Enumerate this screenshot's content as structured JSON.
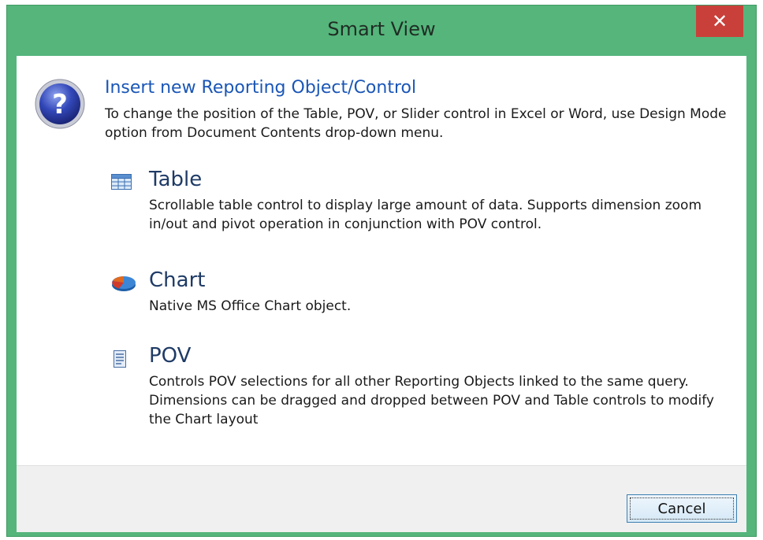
{
  "window": {
    "title": "Smart View",
    "close_label": "✕"
  },
  "header": {
    "title": "Insert new Reporting Object/Control",
    "description": "To change the position of the Table, POV, or Slider control in Excel or Word, use Design Mode option from Document Contents drop-down menu."
  },
  "options": [
    {
      "icon": "table-icon",
      "title": "Table",
      "description": "Scrollable table control to display large amount of data. Supports dimension zoom in/out and pivot operation in conjunction with POV control."
    },
    {
      "icon": "chart-icon",
      "title": "Chart",
      "description": "Native MS Office Chart object."
    },
    {
      "icon": "pov-icon",
      "title": "POV",
      "description": "Controls POV selections for all other Reporting Objects linked to the same query. Dimensions can be dragged and dropped between POV and Table controls to modify the Chart layout"
    }
  ],
  "footer": {
    "cancel_label": "Cancel"
  },
  "colors": {
    "frame": "#55b57b",
    "close_button": "#c9403a",
    "header_link": "#1a56b7"
  }
}
